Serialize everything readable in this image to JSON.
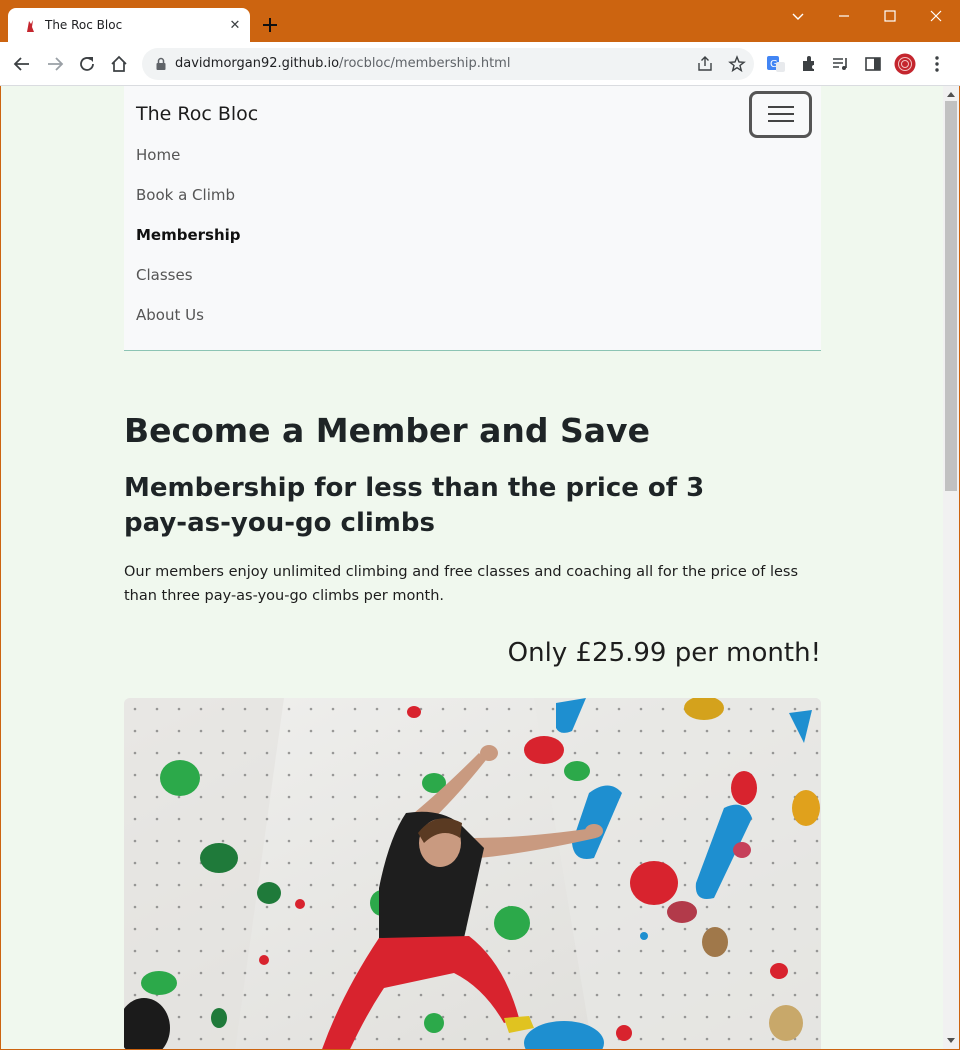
{
  "browser": {
    "tab_title": "The Roc Bloc",
    "url_host": "davidmorgan92.github.io",
    "url_path": "/rocbloc/membership.html",
    "accent_color": "#cc6410"
  },
  "nav": {
    "brand": "The Roc Bloc",
    "items": [
      {
        "label": "Home",
        "active": false
      },
      {
        "label": "Book a Climb",
        "active": false
      },
      {
        "label": "Membership",
        "active": true
      },
      {
        "label": "Classes",
        "active": false
      },
      {
        "label": "About Us",
        "active": false
      }
    ]
  },
  "main": {
    "heading": "Become a Member and Save",
    "subheading": "Membership for less than the price of 3 pay-as-you-go climbs",
    "body": "Our members enjoy unlimited climbing and free classes and coaching all for the price of less than three pay-as-you-go climbs per month.",
    "price": "Only £25.99 per month!"
  },
  "colors": {
    "page_background": "#f0f8ee",
    "navbar_background": "#f8f9fa",
    "climber_shirt": "#1e1e1e",
    "climber_trousers": "#d8232e"
  }
}
